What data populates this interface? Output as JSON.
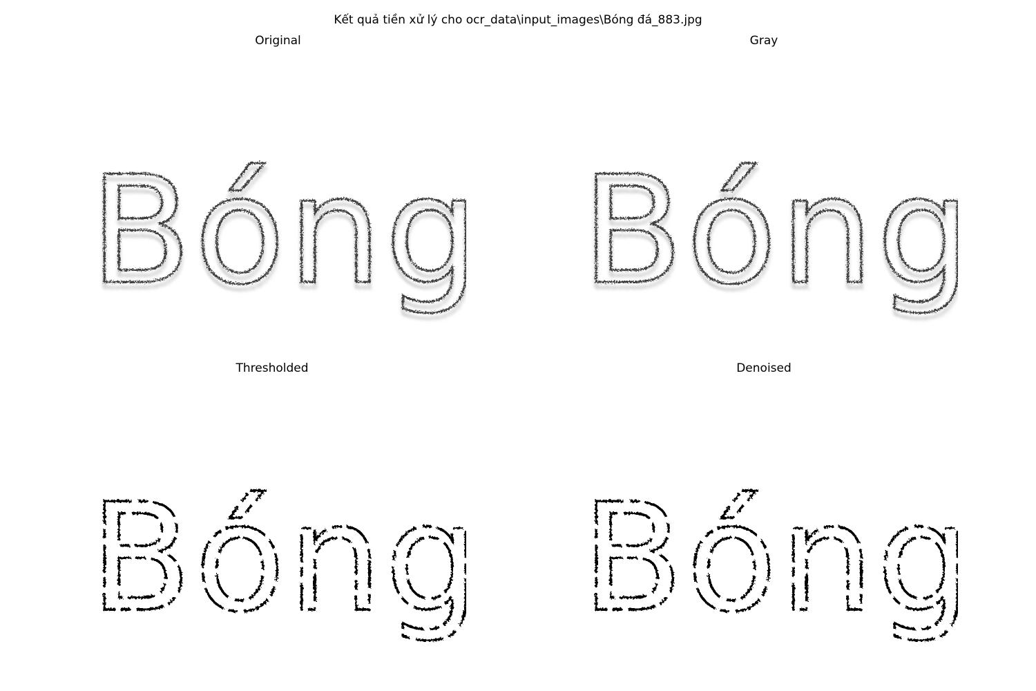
{
  "figure": {
    "title": "Kết quả tiền xử lý cho ocr_data\\input_images\\Bóng đá_883.jpg"
  },
  "panels": [
    {
      "key": "original",
      "title": "Original",
      "depicted_text": "Bóng đá",
      "style": "soft-noisy-gray"
    },
    {
      "key": "gray",
      "title": "Gray",
      "depicted_text": "Bóng đá",
      "style": "soft-noisy-gray"
    },
    {
      "key": "thresholded",
      "title": "Thresholded",
      "depicted_text": "Bóng đá",
      "style": "binary-speckled"
    },
    {
      "key": "denoised",
      "title": "Denoised",
      "depicted_text": "Bóng đá",
      "style": "binary-speckled"
    }
  ],
  "colors": {
    "background": "#ffffff",
    "ink": "#000000",
    "gray_ink": "#3a3a3a",
    "haze": "#d6d6d6"
  }
}
